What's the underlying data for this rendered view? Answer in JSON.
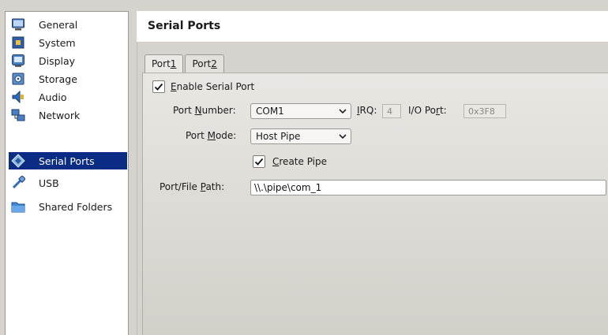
{
  "sidebar": {
    "items": [
      {
        "label": "General",
        "icon": "monitor-icon"
      },
      {
        "label": "System",
        "icon": "chip-icon"
      },
      {
        "label": "Display",
        "icon": "display-icon"
      },
      {
        "label": "Storage",
        "icon": "storage-icon"
      },
      {
        "label": "Audio",
        "icon": "speaker-icon"
      },
      {
        "label": "Network",
        "icon": "network-icon"
      },
      {
        "label": "Serial Ports",
        "icon": "serial-port-icon",
        "selected": true
      },
      {
        "label": "USB",
        "icon": "usb-icon"
      },
      {
        "label": "Shared Folders",
        "icon": "folder-icon"
      }
    ]
  },
  "header": {
    "title": "Serial Ports"
  },
  "tabs": [
    {
      "pre": "Port ",
      "mnemonic": "1",
      "active": true
    },
    {
      "pre": "Port ",
      "mnemonic": "2",
      "active": false
    }
  ],
  "form": {
    "enable": {
      "mnemonic": "E",
      "rest": "nable Serial Port",
      "checked": true
    },
    "port_number": {
      "pre": "Port ",
      "mnemonic": "N",
      "rest": "umber:",
      "value": "COM1"
    },
    "irq": {
      "mnemonic": "I",
      "rest": "RQ:",
      "value": "4"
    },
    "io_port": {
      "pre": "I/O Po",
      "mnemonic": "r",
      "rest": "t:",
      "value": "0x3F8"
    },
    "port_mode": {
      "pre": "Port ",
      "mnemonic": "M",
      "rest": "ode:",
      "value": "Host Pipe"
    },
    "create_pipe": {
      "mnemonic": "C",
      "rest": "reate Pipe",
      "checked": true
    },
    "path": {
      "pre": "Port/File ",
      "mnemonic": "P",
      "rest": "ath:",
      "value": "\\\\.\\pipe\\com_1"
    }
  },
  "colors": {
    "selection": "#0a2c84",
    "panel": "#d6d3ce"
  }
}
